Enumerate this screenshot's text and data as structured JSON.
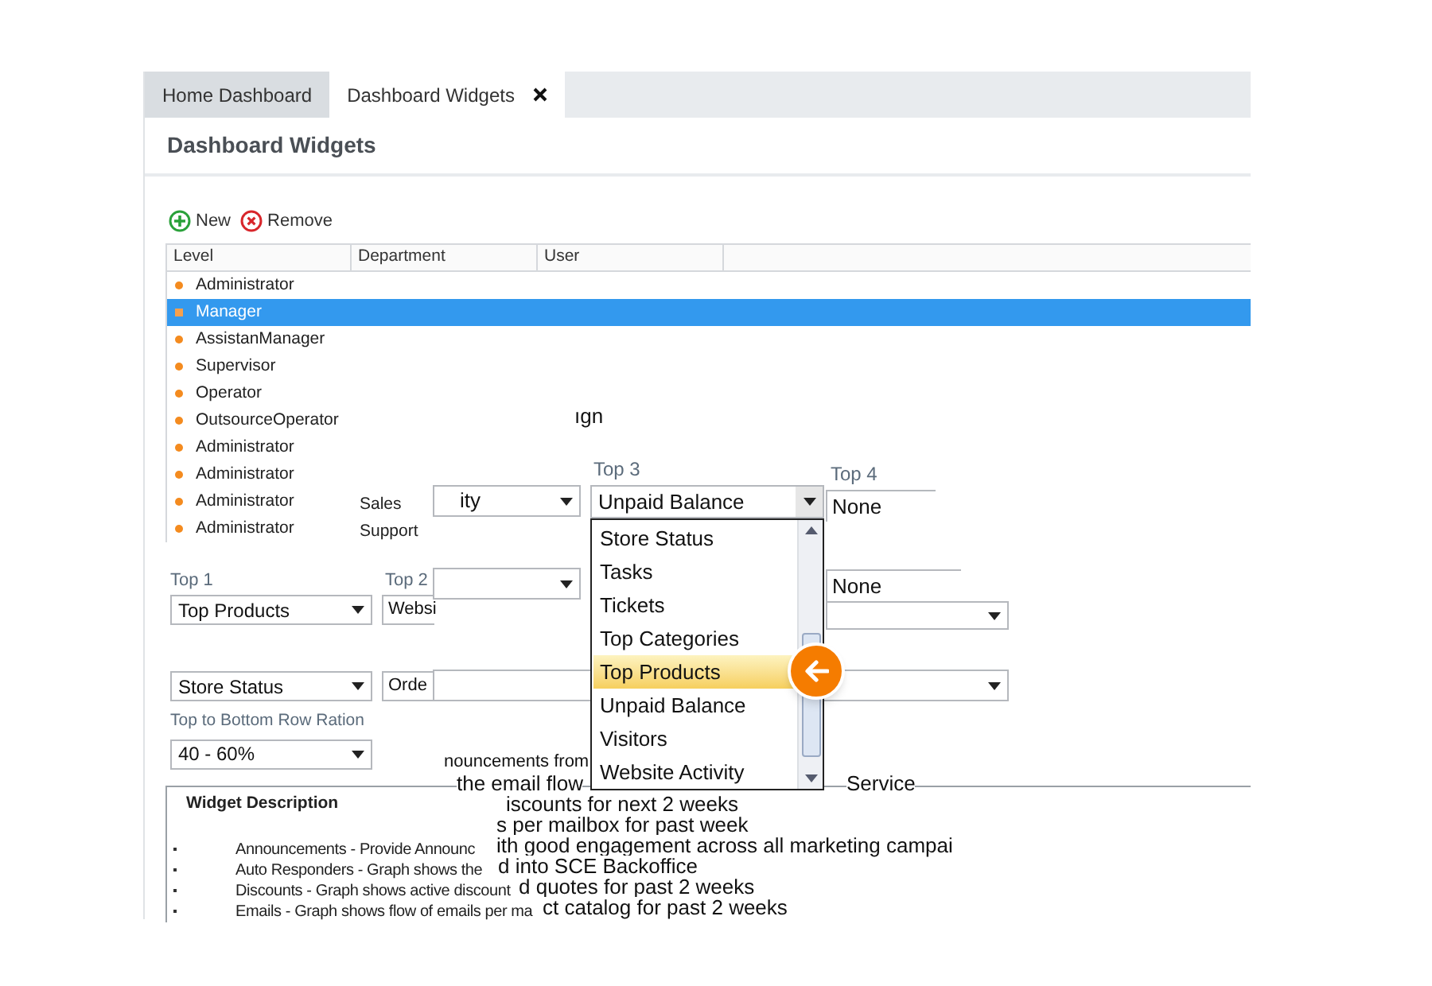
{
  "tabs": [
    {
      "label": "Home Dashboard",
      "selected": false,
      "closable": false
    },
    {
      "label": "Dashboard Widgets",
      "selected": true,
      "closable": true
    }
  ],
  "page_title": "Dashboard Widgets",
  "toolbar": [
    {
      "kind": "add",
      "label": "New"
    },
    {
      "kind": "remove",
      "label": "Remove"
    }
  ],
  "grid": {
    "columns": [
      "Level",
      "Department",
      "User"
    ],
    "rows": [
      {
        "level": "Administrator",
        "selected": false
      },
      {
        "level": "Manager",
        "selected": true
      },
      {
        "level": "AssistanManager",
        "selected": false
      },
      {
        "level": "Supervisor",
        "selected": false
      },
      {
        "level": "Operator",
        "selected": false
      },
      {
        "level": "OutsourceOperator",
        "selected": false
      },
      {
        "level": "Administrator",
        "selected": false
      },
      {
        "level": "Administrator",
        "selected": false
      },
      {
        "level": "Administrator",
        "department": "Sales",
        "selected": false
      },
      {
        "level": "Administrator",
        "department": "Support",
        "selected": false
      }
    ]
  },
  "form": {
    "top1_label": "Top 1",
    "top1": "Top Products",
    "top2_label": "Top 2",
    "top2": "Websi",
    "bottom1": "Store Status",
    "bottom2": "Orde",
    "ratio_label": "Top to Bottom Row Ration",
    "ratio": "40 - 60%"
  },
  "description": {
    "title": "Widget Description",
    "bullets": [
      "Announcements - Provide Announc",
      "Auto Responders - Graph shows the",
      "Discounts - Graph shows active discount",
      "Emails - Graph shows flow of emails per ma"
    ]
  },
  "inset": {
    "fragment": "ıgn",
    "top_select": "ity",
    "top3_label": "Top 3",
    "top3": "Unpaid Balance",
    "top4_label": "Top 4",
    "top4": "None",
    "row2_value": "None",
    "lines": [
      "nouncements from",
      "the email flow",
      "Service",
      "iscounts for next 2 weeks",
      "s per mailbox for past week",
      "ith good engagement across all marketing campai",
      "d into SCE Backoffice",
      "d quotes for past 2 weeks",
      "ct catalog for past 2 weeks"
    ],
    "dropdown": [
      {
        "label": "Store Status",
        "selected": false
      },
      {
        "label": "Tasks",
        "selected": false
      },
      {
        "label": "Tickets",
        "selected": false
      },
      {
        "label": "Top Categories",
        "selected": false
      },
      {
        "label": "Top Products",
        "selected": true
      },
      {
        "label": "Unpaid Balance",
        "selected": false
      },
      {
        "label": "Visitors",
        "selected": false
      },
      {
        "label": "Website Activity",
        "selected": false
      }
    ]
  }
}
